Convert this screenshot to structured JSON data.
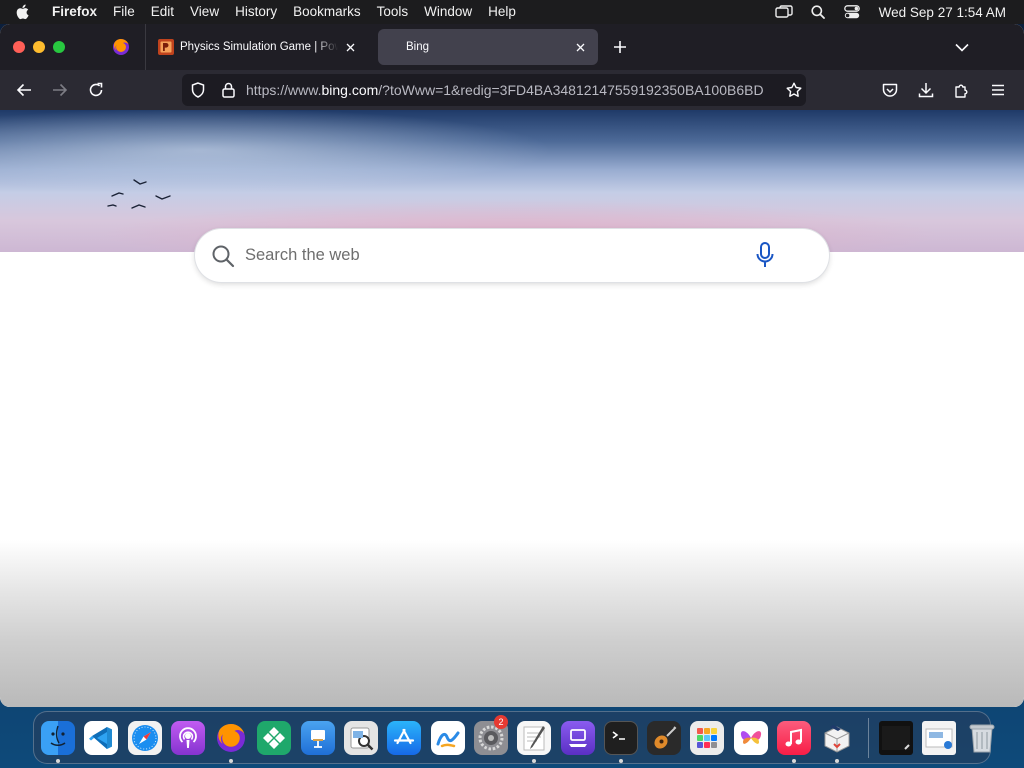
{
  "menubar": {
    "app_name": "Firefox",
    "items": [
      "File",
      "Edit",
      "View",
      "History",
      "Bookmarks",
      "Tools",
      "Window",
      "Help"
    ],
    "clock": "Wed Sep 27  1:54 AM"
  },
  "browser": {
    "tabs": [
      {
        "title": "Physics Simulation Game | PowerPoint",
        "active": false
      },
      {
        "title": "Bing",
        "active": true
      }
    ],
    "url": {
      "scheme": "https://www.",
      "host": "bing.com",
      "rest": "/?toWww=1&redig=3FD4BA34812147559192350BA100B6BD"
    }
  },
  "page": {
    "search": {
      "placeholder": "Search the web",
      "value": ""
    }
  },
  "dock": {
    "apps": [
      {
        "name": "Finder",
        "icon": "finder-icon",
        "running": true,
        "color": "#1e8ff0"
      },
      {
        "name": "Visual Studio Code",
        "icon": "vscode-icon",
        "running": false,
        "color": "#ffffff"
      },
      {
        "name": "Safari",
        "icon": "safari-icon",
        "running": false,
        "color": "#ffffff"
      },
      {
        "name": "Podcasts",
        "icon": "podcasts-icon",
        "running": false,
        "color": "#9b3fd6"
      },
      {
        "name": "Firefox",
        "icon": "firefox-icon",
        "running": true,
        "color": "#3b1f6a"
      },
      {
        "name": "Klokki",
        "icon": "diamond-icon",
        "running": false,
        "color": "#1fa86b"
      },
      {
        "name": "Keynote",
        "icon": "keynote-icon",
        "running": false,
        "color": "#2a88e6"
      },
      {
        "name": "Preview",
        "icon": "preview-icon",
        "running": false,
        "color": "#d8d8d8"
      },
      {
        "name": "App Store",
        "icon": "appstore-icon",
        "running": false,
        "color": "#1a83f0"
      },
      {
        "name": "Freeform",
        "icon": "freeform-icon",
        "running": false,
        "color": "#ffffff"
      },
      {
        "name": "System Settings",
        "icon": "gear-icon",
        "running": false,
        "color": "#8e8e93",
        "badge": "2"
      },
      {
        "name": "TextEdit",
        "icon": "textedit-icon",
        "running": true,
        "color": "#f4f4f4"
      },
      {
        "name": "Apple Configurator",
        "icon": "configurator-icon",
        "running": false,
        "color": "#6b3fd0"
      },
      {
        "name": "Terminal",
        "icon": "terminal-icon",
        "running": true,
        "color": "#1f1f1f"
      },
      {
        "name": "GarageBand",
        "icon": "guitar-icon",
        "running": false,
        "color": "#2a2a2a"
      },
      {
        "name": "Mosaic",
        "icon": "grid-icon",
        "running": false,
        "color": "#e8e8e8"
      },
      {
        "name": "Craft",
        "icon": "butterfly-icon",
        "running": false,
        "color": "#ffffff"
      },
      {
        "name": "Music",
        "icon": "music-icon",
        "running": true,
        "color": "#fa2d48"
      },
      {
        "name": "Archive Utility",
        "icon": "box-icon",
        "running": true,
        "color": "#f0f0f0"
      }
    ],
    "stacks": [
      {
        "name": "Recent Window",
        "icon": "window-thumbnail-icon"
      },
      {
        "name": "Downloads",
        "icon": "folder-thumbnail-icon"
      },
      {
        "name": "Trash",
        "icon": "trash-icon"
      }
    ]
  }
}
